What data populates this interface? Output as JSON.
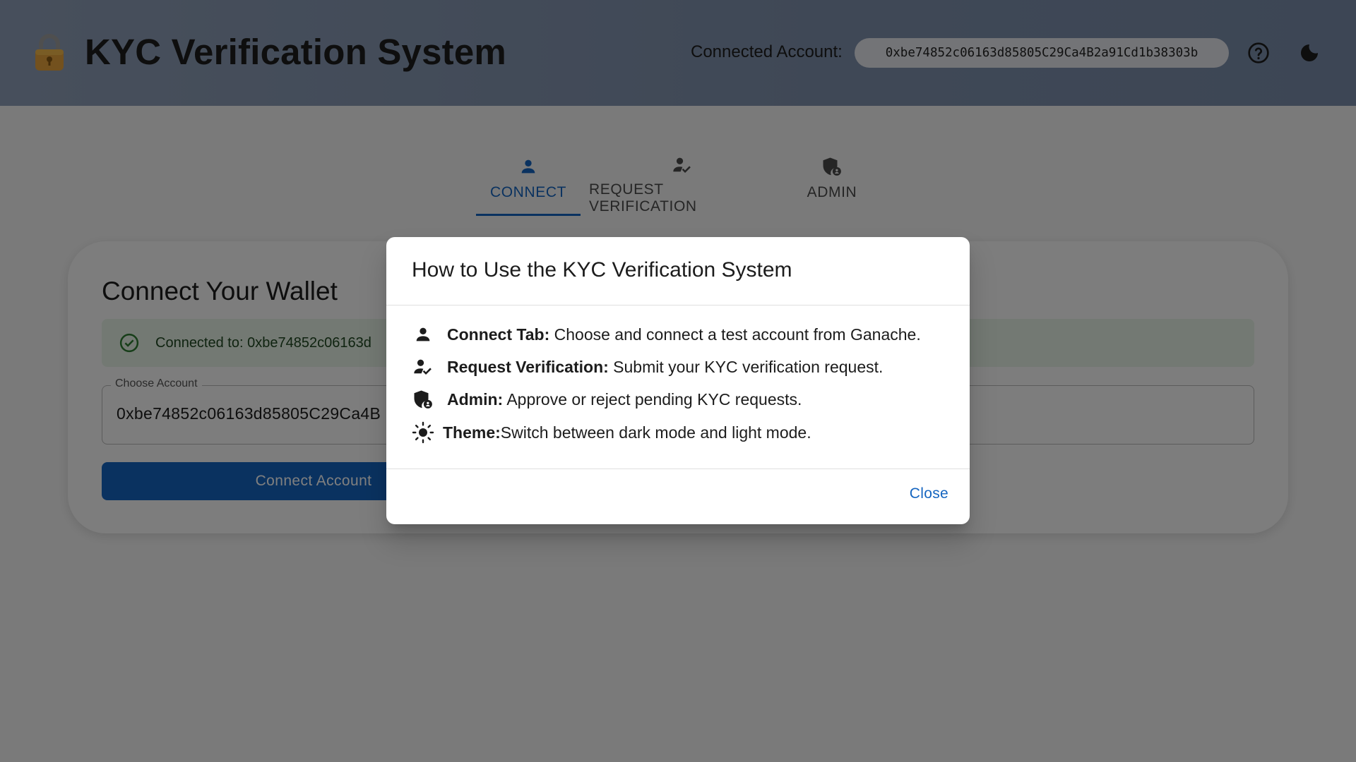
{
  "header": {
    "title": "KYC Verification System",
    "connected_label": "Connected Account:",
    "connected_address": "0xbe74852c06163d85805C29Ca4B2a91Cd1b38303b",
    "help_icon": "help-circle-icon",
    "theme_icon": "moon-icon"
  },
  "tabs": [
    {
      "label": "CONNECT",
      "icon": "person-icon",
      "active": true
    },
    {
      "label": "REQUEST VERIFICATION",
      "icon": "person-check-icon",
      "active": false
    },
    {
      "label": "ADMIN",
      "icon": "admin-shield-icon",
      "active": false
    }
  ],
  "connect_card": {
    "title": "Connect Your Wallet",
    "alert_text": "Connected to: 0xbe74852c06163d",
    "select_label": "Choose Account",
    "select_value": "0xbe74852c06163d85805C29Ca4B",
    "button_label": "Connect Account"
  },
  "dialog": {
    "title": "How to Use the KYC Verification System",
    "items": [
      {
        "bold": "Connect Tab:",
        "text": " Choose and connect a test account from Ganache.",
        "icon": "person-icon"
      },
      {
        "bold": "Request Verification:",
        "text": " Submit your KYC verification request.",
        "icon": "person-check-icon"
      },
      {
        "bold": "Admin:",
        "text": " Approve or reject pending KYC requests.",
        "icon": "admin-shield-icon"
      },
      {
        "bold": "Theme:",
        "text": "Switch between dark mode and light mode.",
        "icon": "sun-icon"
      }
    ],
    "close_label": "Close"
  },
  "colors": {
    "primary": "#1565c0",
    "header_bg": "#8f9fb8",
    "success_bg": "#e6f3e6",
    "success_fg": "#2e7d32"
  }
}
